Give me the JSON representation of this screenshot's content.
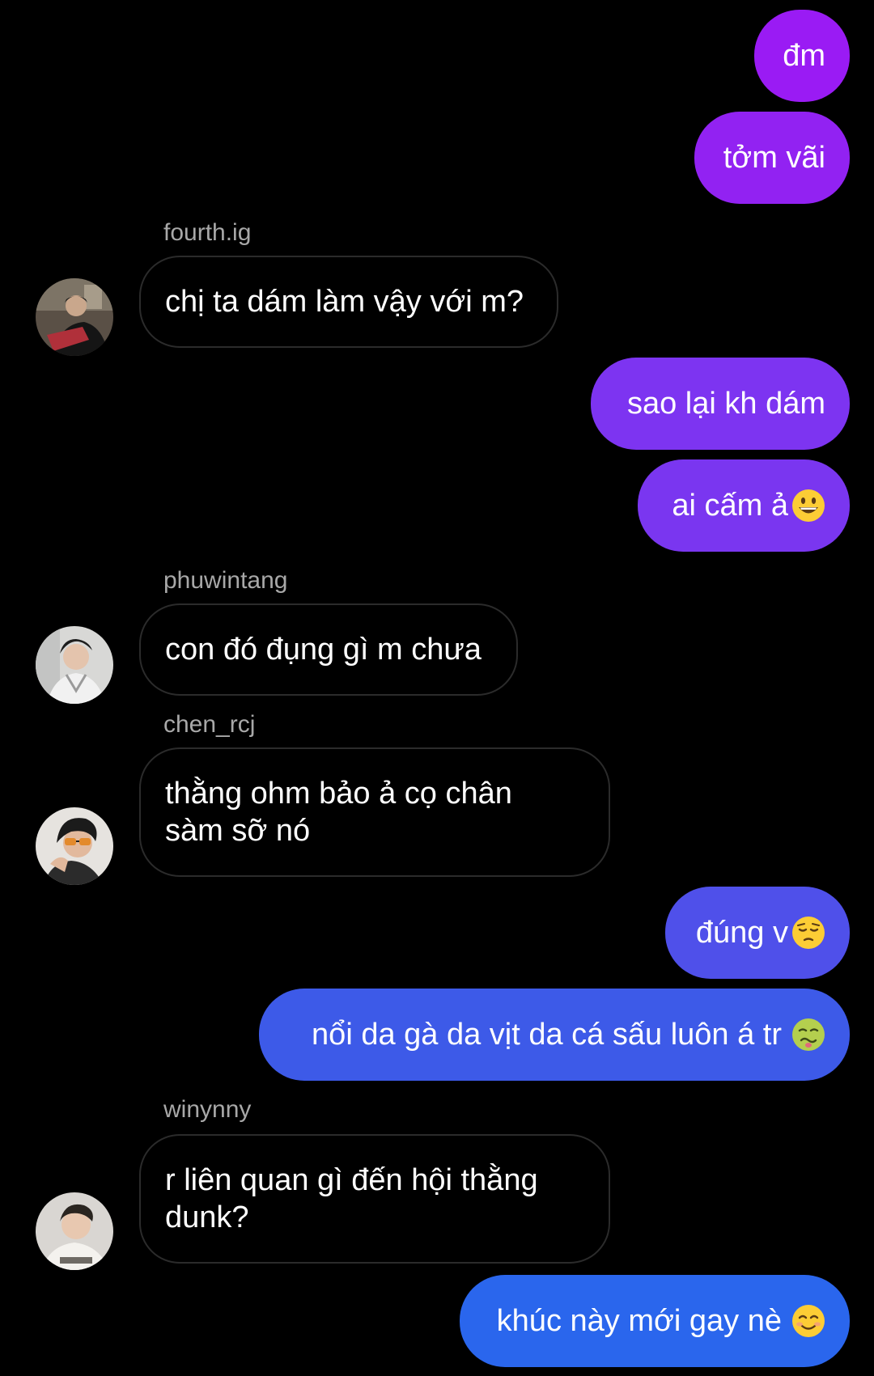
{
  "messages": [
    {
      "type": "outgoing",
      "text": "đm",
      "color": "#9a1bf4"
    },
    {
      "type": "outgoing",
      "text": "tởm vãi",
      "color": "#9222f2"
    },
    {
      "type": "incoming",
      "sender": "fourth.ig",
      "text": "chị ta dám làm vậy với m?",
      "avatar": "person-photo-avatar"
    },
    {
      "type": "outgoing",
      "text": "sao lại kh dám",
      "color": "#7d34f1"
    },
    {
      "type": "outgoing",
      "text": "ai cấm ả",
      "emoji": "grinning-face",
      "color": "#7a36f0"
    },
    {
      "type": "incoming",
      "sender": "phuwintang",
      "text": "con đó đụng gì m chưa",
      "avatar": "person-photo-avatar"
    },
    {
      "type": "incoming",
      "sender": "chen_rcj",
      "text": "thằng ohm bảo ả cọ chân sàm sỡ nó",
      "avatar": "person-photo-avatar"
    },
    {
      "type": "outgoing",
      "text": "đúng v",
      "emoji": "pensive-face",
      "color": "#4f50ea"
    },
    {
      "type": "outgoing",
      "text": "nổi da gà da vịt da cá sấu luôn á tr",
      "emoji": "nauseated-face",
      "color": "#3d5ae8"
    },
    {
      "type": "incoming",
      "sender": "winynny",
      "text": "r liên quan gì đến hội thằng dunk?",
      "avatar": "person-photo-avatar"
    },
    {
      "type": "outgoing",
      "text": "khúc này mới gay nè",
      "emoji": "smiling-face",
      "color": "#2a66ed"
    }
  ]
}
